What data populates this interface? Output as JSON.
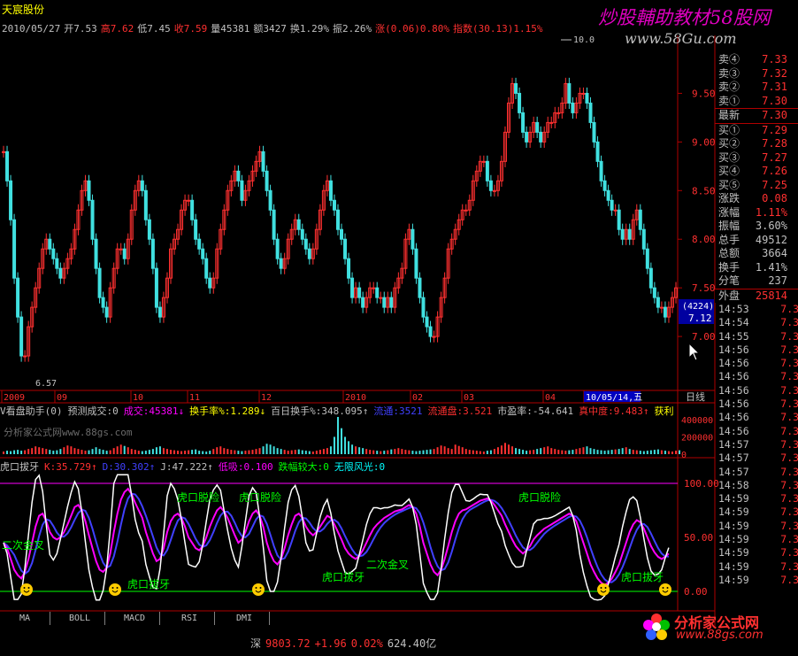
{
  "title": "天宸股份",
  "watermark": {
    "cn": "炒股輔助教材58股网",
    "url": "www.58Gu.com"
  },
  "quote_line": [
    {
      "text": "2010/05/27",
      "color": "#c0c0c0"
    },
    {
      "text": "开7.53",
      "color": "#c0c0c0"
    },
    {
      "text": "高7.62",
      "color": "#ff3030"
    },
    {
      "text": "低7.45",
      "color": "#c0c0c0"
    },
    {
      "text": "收7.59",
      "color": "#ff3030"
    },
    {
      "text": "量45381",
      "color": "#c0c0c0"
    },
    {
      "text": "额3427",
      "color": "#c0c0c0"
    },
    {
      "text": "换1.29%",
      "color": "#c0c0c0"
    },
    {
      "text": "振2.26%",
      "color": "#c0c0c0"
    },
    {
      "text": "涨(0.06)0.80%",
      "color": "#ff3030"
    },
    {
      "text": "指数(30.13)1.15%",
      "color": "#ff3030"
    }
  ],
  "price_axis": [
    "9.50",
    "9.00",
    "8.50",
    "8.00",
    "7.50",
    "7.00"
  ],
  "price_marks": {
    "high": "10.0",
    "low": "6.57",
    "cursor_a": "(4224)",
    "cursor_b": "7.12"
  },
  "time_axis": [
    "2009",
    "09",
    "10",
    "11",
    "12",
    "2010",
    "02",
    "03",
    "04",
    "10/05/14,五"
  ],
  "period_label": "日线",
  "order_book": [
    {
      "label": "卖④",
      "value": "7.33"
    },
    {
      "label": "卖③",
      "value": "7.32"
    },
    {
      "label": "卖②",
      "value": "7.31"
    },
    {
      "label": "卖①",
      "value": "7.30"
    },
    {
      "label": "最新",
      "value": "7.30"
    },
    {
      "label": "买①",
      "value": "7.29"
    },
    {
      "label": "买②",
      "value": "7.28"
    },
    {
      "label": "买③",
      "value": "7.27"
    },
    {
      "label": "买④",
      "value": "7.26"
    },
    {
      "label": "买⑤",
      "value": "7.25"
    }
  ],
  "stats": [
    {
      "label": "涨跌",
      "value": "0.08",
      "color": "#ff3030"
    },
    {
      "label": "涨幅",
      "value": "1.11%",
      "color": "#ff3030"
    },
    {
      "label": "振幅",
      "value": "3.60%",
      "color": "#c0c0c0"
    },
    {
      "label": "总手",
      "value": "49512",
      "color": "#c0c0c0"
    },
    {
      "label": "总额",
      "value": "3664",
      "color": "#c0c0c0"
    },
    {
      "label": "换手",
      "value": "1.41%",
      "color": "#c0c0c0"
    },
    {
      "label": "分笔",
      "value": "237",
      "color": "#c0c0c0"
    },
    {
      "label": "外盘",
      "value": "25814",
      "color": "#ff3030"
    }
  ],
  "ticks": [
    {
      "time": "14:53",
      "price": "7.30"
    },
    {
      "time": "14:54",
      "price": "7.30"
    },
    {
      "time": "14:55",
      "price": "7.30"
    },
    {
      "time": "14:56",
      "price": "7.30"
    },
    {
      "time": "14:56",
      "price": "7.30"
    },
    {
      "time": "14:56",
      "price": "7.30"
    },
    {
      "time": "14:56",
      "price": "7.30"
    },
    {
      "time": "14:56",
      "price": "7.30"
    },
    {
      "time": "14:56",
      "price": "7.30"
    },
    {
      "time": "14:56",
      "price": "7.30"
    },
    {
      "time": "14:57",
      "price": "7.30"
    },
    {
      "time": "14:57",
      "price": "7.30"
    },
    {
      "time": "14:57",
      "price": "7.30"
    },
    {
      "time": "14:58",
      "price": "7.30"
    },
    {
      "time": "14:59",
      "price": "7.30"
    },
    {
      "time": "14:59",
      "price": "7.30"
    },
    {
      "time": "14:59",
      "price": "7.30"
    },
    {
      "time": "14:59",
      "price": "7.30"
    },
    {
      "time": "14:59",
      "price": "7.30"
    },
    {
      "time": "14:59",
      "price": "7.30"
    },
    {
      "time": "14:59",
      "price": "7.30"
    }
  ],
  "vol_indicator": [
    {
      "text": "V看盘助手(0)",
      "color": "#c0c0c0"
    },
    {
      "text": "预测成交:0",
      "color": "#c0c0c0"
    },
    {
      "text": "成交:45381↓",
      "color": "#ff00ff"
    },
    {
      "text": "换手率%:1.289↓",
      "color": "#ffff00"
    },
    {
      "text": "百日换手%:348.095↑",
      "color": "#c0c0c0"
    },
    {
      "text": "流通:3521",
      "color": "#4040ff"
    },
    {
      "text": "流通盘:3.521",
      "color": "#ff3030"
    },
    {
      "text": "市盈率:-54.641",
      "color": "#c0c0c0"
    },
    {
      "text": "真中度:9.483↑",
      "color": "#ff3030"
    },
    {
      "text": "获利",
      "color": "#ffff00"
    }
  ],
  "vol_axis": [
    "400000",
    "200000",
    "0"
  ],
  "vol_watermark": "分析家公式网www.88gs.com",
  "kdj_indicator": [
    {
      "text": "虎口拔牙",
      "color": "#c0c0c0"
    },
    {
      "text": "K:35.729↑",
      "color": "#ff3030"
    },
    {
      "text": "D:30.302↑",
      "color": "#4040ff"
    },
    {
      "text": "J:47.222↑",
      "color": "#c0c0c0"
    },
    {
      "text": "低吸:0.100",
      "color": "#ff00ff"
    },
    {
      "text": "跌幅较大:0",
      "color": "#00ff00"
    },
    {
      "text": "无限风光:0",
      "color": "#00ffff"
    }
  ],
  "kdj_axis": [
    "100.00",
    "50.00",
    "0.00"
  ],
  "kdj_labels": [
    {
      "text": "虎口脱险",
      "color": "#00ff00"
    },
    {
      "text": "虎口脱险",
      "color": "#00ff00"
    },
    {
      "text": "虎口脱险",
      "color": "#00ff00"
    },
    {
      "text": "二次金叉",
      "color": "#00ff00"
    },
    {
      "text": "二次金叉",
      "color": "#00ff00"
    },
    {
      "text": "虎口拔牙",
      "color": "#00ff00"
    },
    {
      "text": "虎口拔牙",
      "color": "#00ff00"
    },
    {
      "text": "虎口拔牙",
      "color": "#00ff00"
    }
  ],
  "tabs": [
    "MA",
    "BOLL",
    "MACD",
    "RSI",
    "DMI"
  ],
  "status_bar": [
    {
      "text": "深",
      "color": "#c0c0c0"
    },
    {
      "text": "9803.72",
      "color": "#ff3030"
    },
    {
      "text": "+1.96",
      "color": "#ff3030"
    },
    {
      "text": "0.02%",
      "color": "#ff3030"
    },
    {
      "text": "624.40亿",
      "color": "#c0c0c0"
    }
  ],
  "logo": {
    "name": "分析家公式网",
    "url": "www.88gs.com"
  },
  "colors": {
    "up": "#ff3030",
    "down": "#40e0e0",
    "axis": "#b00000",
    "k": "#ff00ff",
    "d": "#4040ff",
    "j": "#ffffff"
  },
  "chart_data": {
    "type": "candlestick",
    "ylim": [
      6.5,
      10.05
    ],
    "closes": [
      8.9,
      8.6,
      8.2,
      7.6,
      7.2,
      6.8,
      6.8,
      7.1,
      7.3,
      7.5,
      7.7,
      7.9,
      8.0,
      7.9,
      7.8,
      7.7,
      7.6,
      7.7,
      7.8,
      7.9,
      8.1,
      8.3,
      8.5,
      8.6,
      8.4,
      8.0,
      7.7,
      7.4,
      7.3,
      7.2,
      7.5,
      7.7,
      7.9,
      7.9,
      7.8,
      8.0,
      8.3,
      8.5,
      8.6,
      8.5,
      8.2,
      8.0,
      7.7,
      7.3,
      7.2,
      7.4,
      7.6,
      7.9,
      8.0,
      8.1,
      8.3,
      8.4,
      8.4,
      8.2,
      8.0,
      7.9,
      7.8,
      7.6,
      7.5,
      7.6,
      7.9,
      8.1,
      8.3,
      8.5,
      8.6,
      8.7,
      8.6,
      8.4,
      8.5,
      8.6,
      8.7,
      8.8,
      8.9,
      8.7,
      8.5,
      8.3,
      8.0,
      7.8,
      7.7,
      7.8,
      8.0,
      8.1,
      8.2,
      8.1,
      8.0,
      7.9,
      7.8,
      7.9,
      8.1,
      8.3,
      8.5,
      8.6,
      8.4,
      8.3,
      8.1,
      8.0,
      7.8,
      7.6,
      7.4,
      7.5,
      7.4,
      7.3,
      7.4,
      7.5,
      7.5,
      7.4,
      7.4,
      7.3,
      7.4,
      7.3,
      7.5,
      7.6,
      7.7,
      8.0,
      8.1,
      7.9,
      7.6,
      7.4,
      7.2,
      7.1,
      7.0,
      7.0,
      7.2,
      7.4,
      7.6,
      7.9,
      8.0,
      8.1,
      8.2,
      8.3,
      8.3,
      8.4,
      8.6,
      8.7,
      8.8,
      8.8,
      8.6,
      8.5,
      8.5,
      8.6,
      8.8,
      9.1,
      9.4,
      9.6,
      9.5,
      9.3,
      9.1,
      9.0,
      9.1,
      9.2,
      9.1,
      9.0,
      9.1,
      9.2,
      9.2,
      9.3,
      9.3,
      9.4,
      9.6,
      9.4,
      9.3,
      9.4,
      9.5,
      9.5,
      9.4,
      9.2,
      9.0,
      8.8,
      8.6,
      8.5,
      8.4,
      8.3,
      8.3,
      8.1,
      8.0,
      8.1,
      8.0,
      8.2,
      8.3,
      8.1,
      7.9,
      7.7,
      7.5,
      7.4,
      7.3,
      7.3,
      7.2,
      7.3,
      7.4,
      7.5
    ],
    "volumes": [
      30,
      40,
      35,
      45,
      50,
      40,
      45,
      60,
      70,
      90,
      80,
      70,
      60,
      50,
      40,
      45,
      60,
      80,
      100,
      90,
      70,
      60,
      50,
      40,
      45,
      60,
      80,
      60,
      50,
      40,
      45,
      70,
      90,
      110,
      95,
      80,
      60,
      50,
      40,
      35,
      40,
      50,
      60,
      80,
      90,
      70,
      60,
      50,
      45,
      40,
      35,
      40,
      45,
      50,
      55,
      40,
      35,
      30,
      40,
      60,
      80,
      90,
      70,
      60,
      50,
      45,
      40,
      35,
      40,
      45,
      50,
      60,
      70,
      90,
      120,
      110,
      90,
      70,
      60,
      50,
      40,
      45,
      50,
      55,
      45,
      40,
      35,
      30,
      40,
      50,
      60,
      70,
      90,
      200,
      430,
      300,
      200,
      150,
      110,
      90,
      80,
      70,
      60,
      50,
      45,
      40,
      35,
      40,
      45,
      55,
      60,
      70,
      60,
      50,
      45,
      40,
      35,
      40,
      45,
      50,
      55,
      60,
      80,
      100,
      90,
      70,
      60,
      110,
      95,
      80,
      60,
      50,
      45,
      40,
      35,
      30,
      40,
      45,
      60,
      80,
      100,
      130,
      110,
      90,
      70,
      60,
      50,
      40,
      45,
      50,
      60,
      70,
      80,
      90,
      70,
      60,
      50,
      45,
      40,
      45,
      50,
      60,
      70,
      80,
      90,
      70,
      60,
      50,
      45,
      40,
      45,
      50,
      55,
      60,
      70,
      80,
      60,
      50,
      45,
      40,
      35,
      40,
      45,
      50,
      55,
      45,
      40,
      35,
      30,
      40,
      45
    ],
    "k": [
      45,
      40,
      30,
      20,
      15,
      12,
      18,
      30,
      45,
      60,
      70,
      72,
      65,
      55,
      50,
      48,
      50,
      55,
      62,
      70,
      78,
      80,
      75,
      65,
      52,
      40,
      28,
      20,
      18,
      22,
      35,
      55,
      72,
      85,
      92,
      95,
      90,
      82,
      75,
      68,
      55,
      45,
      35,
      28,
      30,
      40,
      55,
      65,
      70,
      72,
      68,
      60,
      50,
      45,
      40,
      38,
      42,
      50,
      60,
      68,
      75,
      78,
      74,
      68,
      60,
      52,
      45,
      48,
      55,
      65,
      72,
      75,
      70,
      60,
      45,
      35,
      28,
      25,
      30,
      40,
      52,
      62,
      70,
      72,
      68,
      60,
      55,
      52,
      55,
      60,
      65,
      70,
      68,
      62,
      55,
      48,
      40,
      35,
      32,
      30,
      33,
      38,
      45,
      52,
      58,
      62,
      65,
      68,
      70,
      72,
      74,
      75,
      76,
      78,
      80,
      78,
      72,
      60,
      45,
      35,
      25,
      18,
      15,
      20,
      30,
      42,
      55,
      65,
      72,
      75,
      76,
      78,
      80,
      82,
      84,
      85,
      86,
      84,
      80,
      75,
      70,
      62,
      55,
      48,
      42,
      38,
      35,
      38,
      42,
      48,
      52,
      55,
      58,
      60,
      62,
      64,
      66,
      68,
      70,
      72,
      70,
      65,
      55,
      45,
      35,
      25,
      18,
      12,
      8,
      6,
      8,
      12,
      18,
      25,
      35,
      45,
      55,
      62,
      66,
      64,
      58,
      50,
      42,
      36,
      32,
      30,
      32,
      35
    ],
    "tiger_mouth": "虎口脱险"
  }
}
